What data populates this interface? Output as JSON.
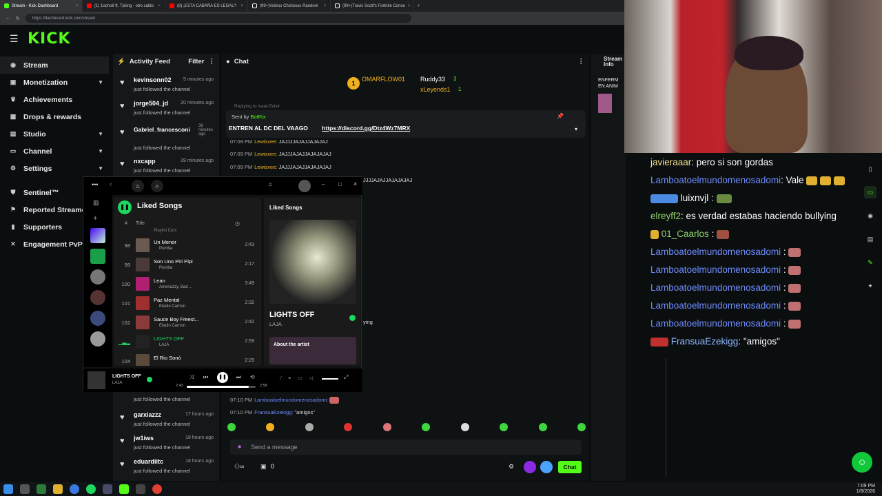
{
  "browser": {
    "tabs": [
      "Stream - Kick Dashboard",
      "(1) 1ocho8 ft. Tyking - otro caldo",
      "(8) ¡ESTA CABAÑA ES LEGAL?",
      "(99+)Videos Chistosos Random",
      "(99+)Travis Scott's Fortnite Conce"
    ],
    "url": "https://dashboard.kick.com/stream"
  },
  "app": {
    "logo": "KICK"
  },
  "sidebar": {
    "items": [
      "Stream",
      "Monetization",
      "Achievements",
      "Drops & rewards",
      "Studio",
      "Channel",
      "Settings"
    ],
    "items2": [
      "Sentinel™",
      "Reported Streame",
      "Supporters",
      "Engagement PvP"
    ]
  },
  "feed": {
    "title": "Activity Feed",
    "filter": "Filter",
    "items": [
      {
        "user": "kevinsonn02",
        "time": "5 minutes ago",
        "action": "just followed the channel"
      },
      {
        "user": "jorge504_jd",
        "time": "20 minutes ago",
        "action": "just followed the channel"
      },
      {
        "user": "Gabriel_francesconi",
        "time": "38 minutes ago",
        "action": "just followed the channel"
      },
      {
        "user": "nxcapp",
        "time": "39 minutes ago",
        "action": "just followed the channel"
      },
      {
        "user": "",
        "time": "",
        "action": "just followed the channel"
      },
      {
        "user": "garxiazzz",
        "time": "17 hours ago",
        "action": "just followed the channel"
      },
      {
        "user": "jw1iws",
        "time": "18 hours ago",
        "action": "just followed the channel"
      },
      {
        "user": "eduardiitc",
        "time": "18 hours ago",
        "action": "just followed the channel"
      }
    ]
  },
  "chat": {
    "title": "Chat",
    "top": [
      {
        "name": "OMARFLOW01",
        "count": "1"
      },
      {
        "name": "Ruddy33",
        "count": "3"
      },
      {
        "name": "xLeyends1",
        "count": "1"
      }
    ],
    "replying": "Replying to isaacl7vivir",
    "pinned_by": "Sent by",
    "pinned_user": "BotRix",
    "pinned_text": "ENTREN AL DC DEL VAAGO",
    "pinned_link": "https://discord.gg/Dtz4Wz7MRX",
    "lines": [
      {
        "time": "07:09 PM",
        "user": "Lewisxee:",
        "text": "JAJJJJAJAJJAJAJAJ"
      },
      {
        "time": "07:09 PM",
        "user": "Lewisxee:",
        "text": "JAJJJAJAJJAJAJAJAJ"
      },
      {
        "time": "07:09 PM",
        "user": "Lewisxee:",
        "text": "JAJJJAJAJJAJAJAJAJ"
      },
      {
        "time": "",
        "user": "",
        "text": "JJJJAJAJJAJAJAJAJ"
      },
      {
        "time": "07:10 PM",
        "user": "Lamboatoelmundomenosadomi:",
        "text": ""
      },
      {
        "time": "07:10 PM",
        "user": "FransuaEzekigg:",
        "text": "\"amigos\""
      }
    ],
    "partial": "ying",
    "input_placeholder": "Send a message",
    "count": "0",
    "send": "Chat"
  },
  "stream_info": {
    "title": "Stream Info",
    "text": "ENFERM EN ANIM"
  },
  "spotify": {
    "playlist": "Liked Songs",
    "col_title": "Title",
    "partial_first": "Playlist Curs",
    "songs": [
      {
        "num": "98",
        "title": "Un Menor",
        "artist": "Pumba",
        "dur": "2:43"
      },
      {
        "num": "99",
        "title": "Son Uno Piri Pipi",
        "artist": "Pumba",
        "dur": "2:17"
      },
      {
        "num": "100",
        "title": "Lean",
        "artist": "Amenazzy, Bad ...",
        "dur": "3:49"
      },
      {
        "num": "101",
        "title": "Paz Mental",
        "artist": "Eladio Carrion",
        "dur": "2:32"
      },
      {
        "num": "102",
        "title": "Sauce Boy Freest...",
        "artist": "Eladio Carrion",
        "dur": "2:42"
      },
      {
        "num": "",
        "title": "LIGHTS OFF",
        "artist": "LAJA",
        "dur": "2:59"
      },
      {
        "num": "104",
        "title": "El Rio Sonó",
        "artist": "",
        "dur": "2:29"
      }
    ],
    "right_title": "Liked Songs",
    "now_title": "LIGHTS OFF",
    "now_artist": "LAJA",
    "about": "About the artist",
    "player": {
      "title": "LIGHTS OFF",
      "artist": "LAJA",
      "elapsed": "2:43",
      "total": "2:58",
      "progress": 0.9
    }
  },
  "overlay_chat": {
    "lines": [
      {
        "user": "javieraaar",
        "text": ": pero si son gordas",
        "color": "#f0e090"
      },
      {
        "user": "Lamboatoelmundomenosadomi",
        "text": ": Vale",
        "color": "#6f8cff"
      },
      {
        "user": "luixnvjl",
        "text": ":",
        "color": "#ffffff"
      },
      {
        "user": "elreyff2",
        "text": ": es verdad estabas haciendo bullying",
        "color": "#8fd16a"
      },
      {
        "user": "01_Caarlos",
        "text": ":",
        "color": "#8fd16a"
      },
      {
        "user": "Lamboatoelmundomenosadomi",
        "text": ":",
        "color": "#6f8cff"
      },
      {
        "user": "Lamboatoelmundomenosadomi",
        "text": ":",
        "color": "#6f8cff"
      },
      {
        "user": "Lamboatoelmundomenosadomi",
        "text": ":",
        "color": "#6f8cff"
      },
      {
        "user": "Lamboatoelmundomenosadomi",
        "text": ":",
        "color": "#6f8cff"
      },
      {
        "user": "Lamboatoelmundomenosadomi",
        "text": ":",
        "color": "#6f8cff"
      },
      {
        "user": "FransuaEzekigg",
        "text": ": \"amigos\"",
        "color": "#8fb7ff"
      }
    ]
  },
  "taskbar": {
    "time": "7:09 PM",
    "date": "1/8/2026"
  },
  "colors": {
    "kick_green": "#53fc18",
    "spotify_green": "#1ed760"
  }
}
